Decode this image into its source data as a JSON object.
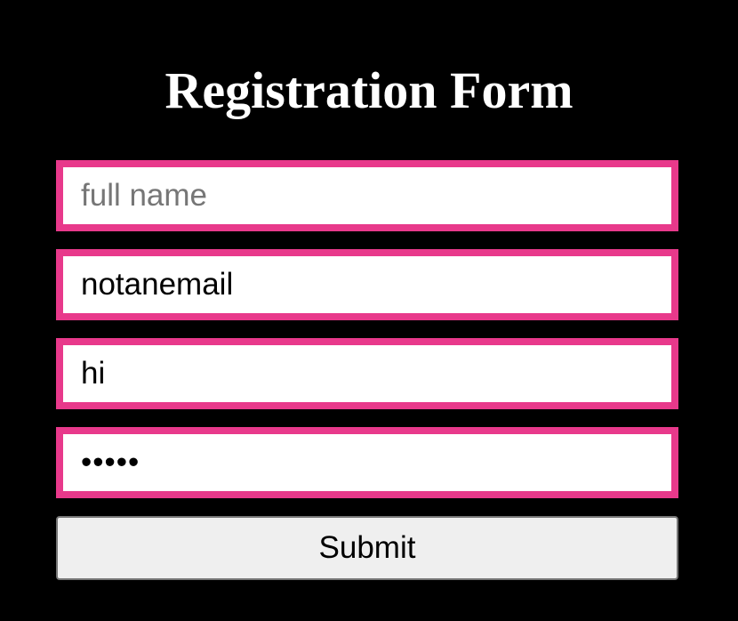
{
  "form": {
    "title": "Registration Form",
    "fields": [
      {
        "name": "full_name",
        "type": "text",
        "placeholder": "full name",
        "value": ""
      },
      {
        "name": "email",
        "type": "text",
        "placeholder": "",
        "value": "notanemail"
      },
      {
        "name": "text",
        "type": "text",
        "placeholder": "",
        "value": "hi"
      },
      {
        "name": "password",
        "type": "password",
        "placeholder": "",
        "value": "•••••"
      }
    ],
    "submit_label": "Submit"
  },
  "colors": {
    "background": "#000000",
    "field_border": "#e8398b",
    "title": "#ffffff"
  }
}
